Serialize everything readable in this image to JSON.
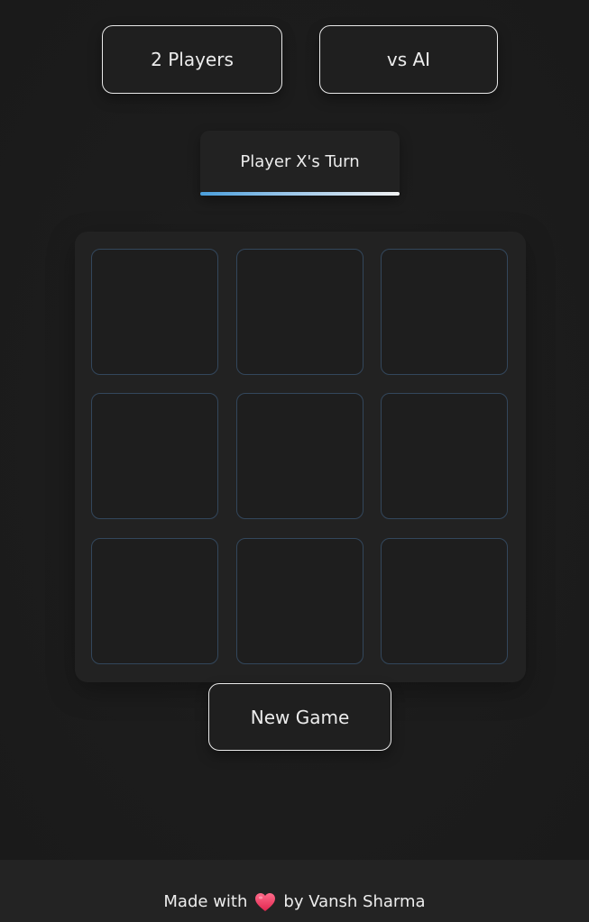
{
  "modes": {
    "two_players_label": "2 Players",
    "vs_ai_label": "vs AI"
  },
  "status": {
    "text": "Player X's Turn"
  },
  "board": {
    "cells": [
      "",
      "",
      "",
      "",
      "",
      "",
      "",
      "",
      ""
    ]
  },
  "actions": {
    "new_game_label": "New Game"
  },
  "footer": {
    "prefix": "Made with",
    "heart_icon": "heart-icon",
    "suffix": "by Vansh Sharma"
  },
  "colors": {
    "accent_blue": "#4a9fdc",
    "cell_border": "#33475c",
    "heart": "#e8395f"
  }
}
